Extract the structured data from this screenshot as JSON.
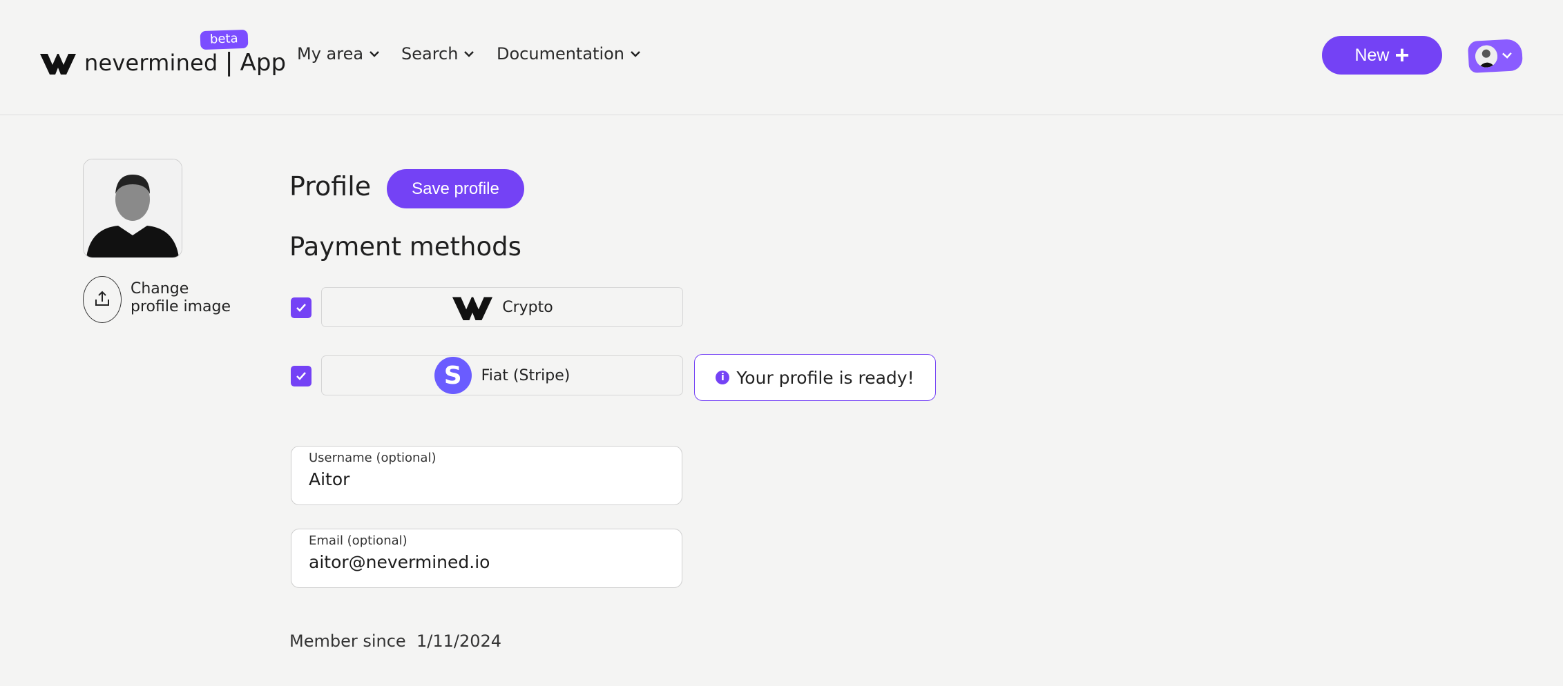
{
  "header": {
    "brand": "nevermined",
    "separator": "|",
    "app": "App",
    "badge": "beta",
    "nav": [
      {
        "label": "My area"
      },
      {
        "label": "Search"
      },
      {
        "label": "Documentation"
      }
    ],
    "new_button": "New",
    "accent": "#7442f5"
  },
  "sidebar": {
    "change_image": "Change profile image"
  },
  "main": {
    "title": "Profile",
    "save_button": "Save profile",
    "payment_title": "Payment methods",
    "methods": [
      {
        "label": "Crypto",
        "checked": true,
        "icon": "nevermined-logo-icon"
      },
      {
        "label": "Fiat (Stripe)",
        "checked": true,
        "icon": "stripe-icon",
        "icon_letter": "S"
      }
    ],
    "toast": "Your profile is ready!",
    "username": {
      "label": "Username (optional)",
      "value": "Aitor"
    },
    "email": {
      "label": "Email (optional)",
      "value": "aitor@nevermined.io"
    },
    "member_label": "Member since",
    "member_date": "1/11/2024"
  }
}
